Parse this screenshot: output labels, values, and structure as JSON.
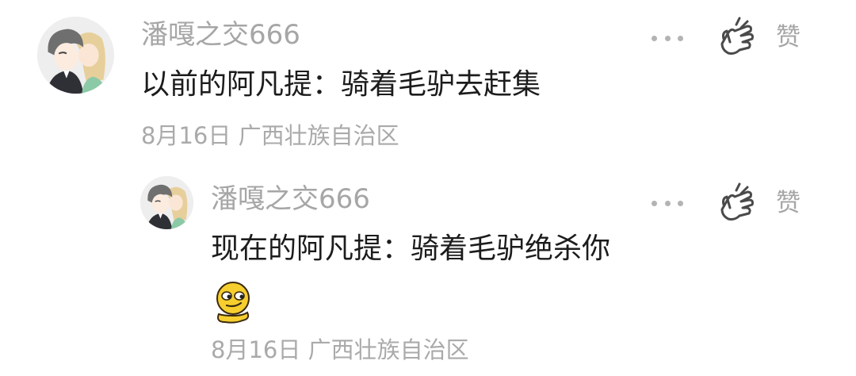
{
  "comment": {
    "username": "潘嘎之交666",
    "text": "以前的阿凡提：骑着毛驴去赶集",
    "date": "8月16日",
    "location": "广西壮族自治区",
    "like_label": "赞"
  },
  "reply": {
    "username": "潘嘎之交666",
    "text": "现在的阿凡提：骑着毛驴绝杀你",
    "date": "8月16日",
    "location": "广西壮族自治区",
    "like_label": "赞",
    "emoji": "sly-smirk-emoji"
  },
  "icons": {
    "more": "more-dots-icon",
    "like": "like-hand-icon"
  },
  "colors": {
    "username": "#a6a6a6",
    "comment_text": "#1c1c1c",
    "meta": "#aaaaaa",
    "emoji_yellow": "#f6cf2e"
  }
}
